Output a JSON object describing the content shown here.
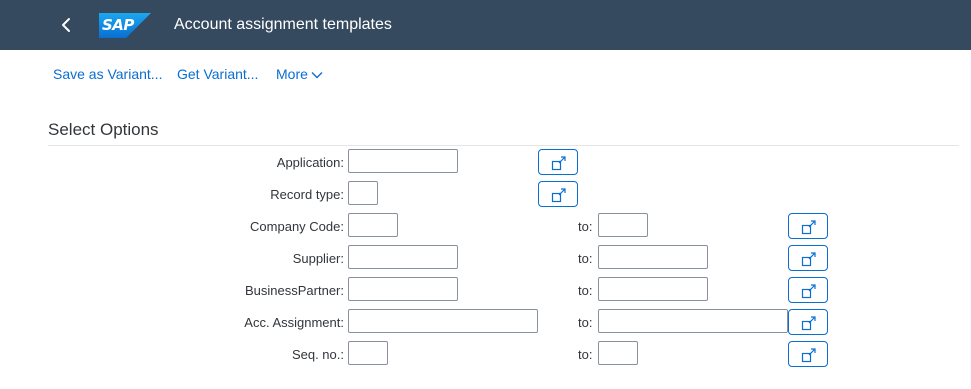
{
  "shell": {
    "title": "Account assignment templates",
    "logo_text": "SAP",
    "brand_color": "#354a5f",
    "back_icon": "chevron-left-icon"
  },
  "toolbar": {
    "save_variant": "Save as Variant...",
    "get_variant": "Get Variant...",
    "more": "More"
  },
  "section": {
    "title": "Select Options"
  },
  "fields": {
    "application": {
      "label": "Application:",
      "value": ""
    },
    "record_type": {
      "label": "Record type:",
      "value": ""
    },
    "company_code": {
      "label": "Company Code:",
      "value": "",
      "to_label": "to:",
      "to_value": ""
    },
    "supplier": {
      "label": "Supplier:",
      "value": "",
      "to_label": "to:",
      "to_value": ""
    },
    "business_partner": {
      "label": "BusinessPartner:",
      "value": "",
      "to_label": "to:",
      "to_value": ""
    },
    "acc_assignment": {
      "label": "Acc. Assignment:",
      "value": "",
      "to_label": "to:",
      "to_value": ""
    },
    "seq_no": {
      "label": "Seq. no.:",
      "value": "",
      "to_label": "to:",
      "to_value": ""
    }
  },
  "multiple_selection_icon": "multiple-selection-icon",
  "accent_color": "#0a6ed1"
}
